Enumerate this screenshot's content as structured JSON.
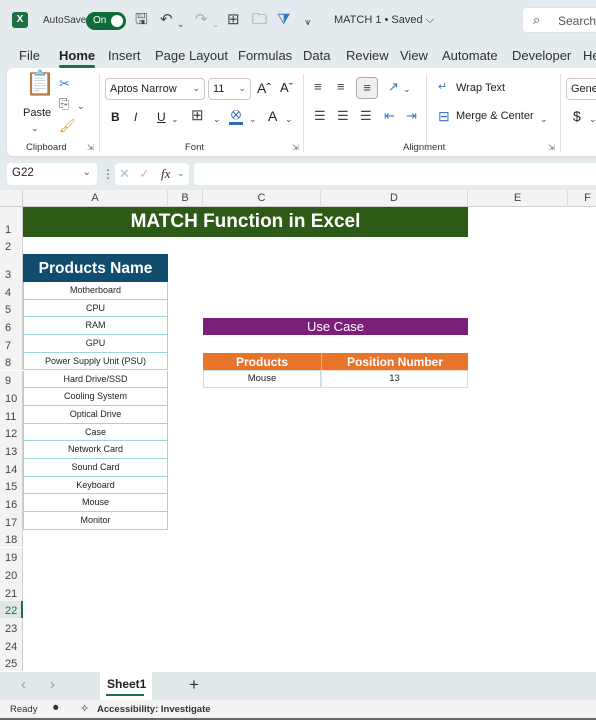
{
  "titlebar": {
    "app_icon": "excel-logo-icon",
    "app_icon_glyph": "X",
    "autosave_label": "AutoSave",
    "autosave_state": "On",
    "doc_title": "MATCH 1 • Saved ⌵",
    "search_placeholder": "Search",
    "icons": [
      "save-icon",
      "undo-icon",
      "redo-icon",
      "borders-icon",
      "open-icon",
      "filter-icon",
      "customize-qat-icon"
    ]
  },
  "menu_tabs": [
    {
      "label": "File",
      "active": false
    },
    {
      "label": "Home",
      "active": true
    },
    {
      "label": "Insert",
      "active": false
    },
    {
      "label": "Page Layout",
      "active": false
    },
    {
      "label": "Formulas",
      "active": false
    },
    {
      "label": "Data",
      "active": false
    },
    {
      "label": "Review",
      "active": false
    },
    {
      "label": "View",
      "active": false
    },
    {
      "label": "Automate",
      "active": false
    },
    {
      "label": "Developer",
      "active": false
    },
    {
      "label": "He",
      "active": false
    }
  ],
  "ribbon": {
    "clipboard": {
      "label": "Clipboard",
      "paste_label": "Paste"
    },
    "font": {
      "label": "Font",
      "font_name": "Aptos Narrow",
      "font_size": "11",
      "bold": "B",
      "italic": "I",
      "underline": "U",
      "grow": "A^",
      "shrink": "Aˇ",
      "font_color": "A"
    },
    "alignment": {
      "label": "Alignment",
      "wrap_text": "Wrap Text",
      "merge_center": "Merge & Center"
    },
    "number": {
      "format": "Gener",
      "currency": "$"
    }
  },
  "formula_bar": {
    "name_box": "G22",
    "fx_label": "fx",
    "formula": ""
  },
  "columns": [
    "A",
    "B",
    "C",
    "D",
    "E",
    "F"
  ],
  "rows": [
    "1",
    "2",
    "3",
    "4",
    "5",
    "6",
    "7",
    "8",
    "9",
    "10",
    "11",
    "12",
    "13",
    "14",
    "15",
    "16",
    "17",
    "18",
    "19",
    "20",
    "21",
    "22",
    "23",
    "24",
    "25"
  ],
  "selected_row": "22",
  "sheet": {
    "title": "MATCH Function in Excel",
    "products_header": "Products Name",
    "products": [
      "Motherboard",
      "CPU",
      "RAM",
      "GPU",
      "Power Supply Unit (PSU)",
      "Hard Drive/SSD",
      "Cooling System",
      "Optical Drive",
      "Case",
      "Network Card",
      "Sound Card",
      "Keyboard",
      "Mouse",
      "Monitor"
    ],
    "use_case": {
      "title": "Use Case",
      "col1_header": "Products",
      "col2_header": "Position Number",
      "product": "Mouse",
      "position": "13"
    },
    "colors": {
      "title_bg": "#2e5a17",
      "header_bg": "#114d6e",
      "use_case_bg": "#7b1f7b",
      "orange": "#e8732b",
      "accent": "#1d6f42"
    }
  },
  "sheet_tabs": {
    "tabs": [
      "Sheet1"
    ],
    "add_label": "+",
    "prev": "‹",
    "next": "›"
  },
  "status_bar": {
    "ready": "Ready",
    "accessibility": "Accessibility: Investigate"
  }
}
